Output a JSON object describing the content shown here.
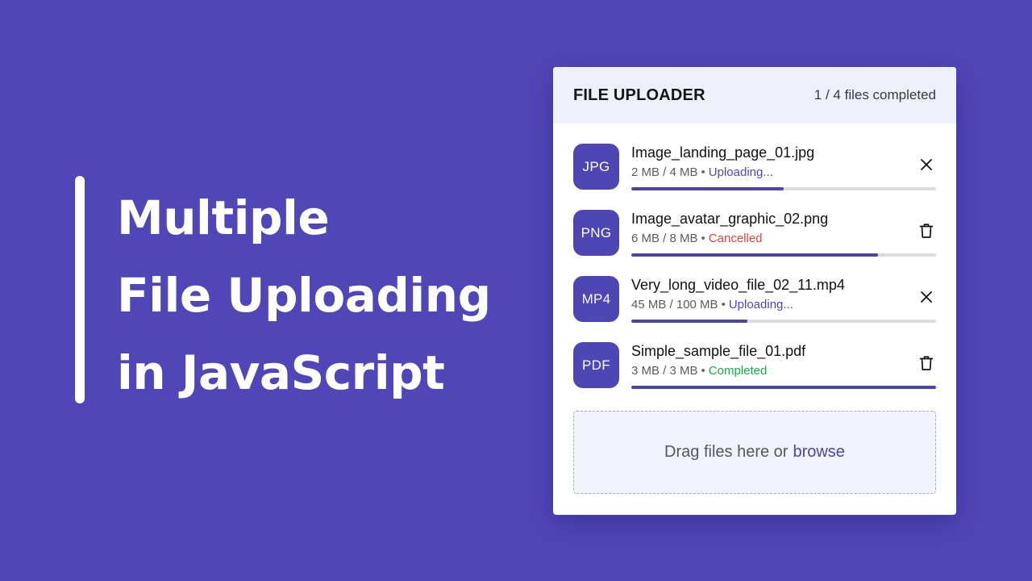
{
  "hero": {
    "lines": [
      "Multiple",
      "File Uploading",
      "in JavaScript"
    ]
  },
  "uploader": {
    "title": "FILE UPLOADER",
    "summary": "1 / 4 files completed",
    "files": [
      {
        "type": "JPG",
        "name": "Image_landing_page_01.jpg",
        "size": "2 MB / 4 MB",
        "status": "Uploading...",
        "progress": 0.5,
        "action": "cancel-icon"
      },
      {
        "type": "PNG",
        "name": "Image_avatar_graphic_02.png",
        "size": "6 MB / 8 MB",
        "status": "Cancelled",
        "progress": 0.81,
        "action": "trash-icon"
      },
      {
        "type": "MP4",
        "name": "Very_long_video_file_02_11.mp4",
        "size": "45 MB / 100 MB",
        "status": "Uploading...",
        "progress": 0.38,
        "action": "cancel-icon"
      },
      {
        "type": "PDF",
        "name": "Simple_sample_file_01.pdf",
        "size": "3 MB / 3 MB",
        "status": "Completed",
        "progress": 1.0,
        "action": "trash-icon"
      }
    ],
    "drop_zone": {
      "text": "Drag files here or",
      "link": "browse"
    }
  },
  "colors": {
    "background": "#5046b8",
    "accent": "#4f46b6",
    "status_uploading": "#4f46b6",
    "status_cancelled": "#d9453f",
    "status_completed": "#1aa84a"
  }
}
